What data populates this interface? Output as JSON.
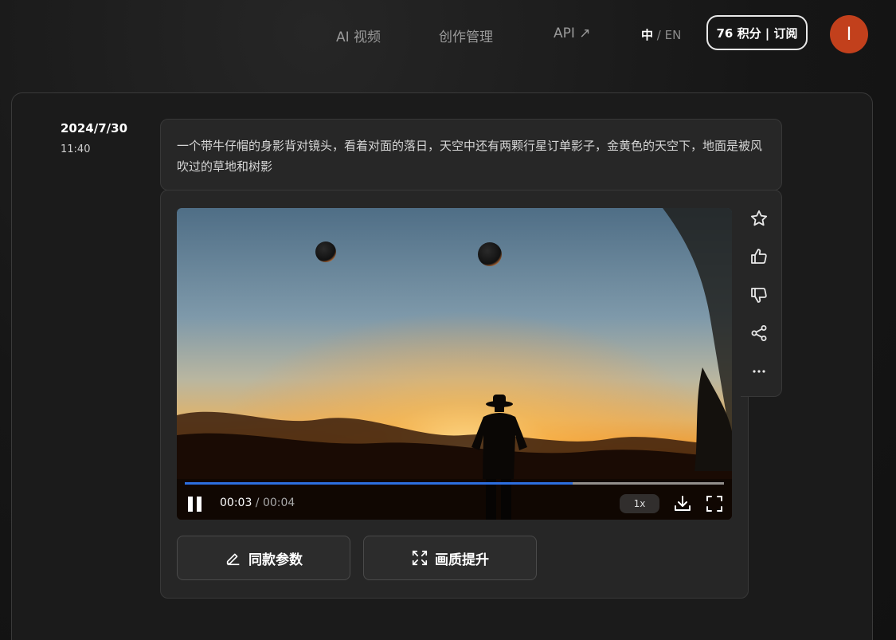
{
  "nav": {
    "items": [
      {
        "label": "AI 视频"
      },
      {
        "label": "创作管理"
      },
      {
        "label": "API ↗"
      }
    ],
    "lang_active": "中",
    "lang_sep": " / ",
    "lang_other": "EN",
    "credits_label": "76 积分 | 订阅",
    "avatar_initial": "I"
  },
  "entry": {
    "date": "2024/7/30",
    "time": "11:40",
    "prompt": "一个带牛仔帽的身影背对镜头，看着对面的落日，天空中还有两颗行星订单影子，金黄色的天空下，地面是被风吹过的草地和树影"
  },
  "video": {
    "current_time": "00:03",
    "separator": " / ",
    "total_time": "00:04",
    "progress": 0.72,
    "speed": "1x"
  },
  "actions": {
    "rail_icons": [
      "star-icon",
      "thumbs-up-icon",
      "thumbs-down-icon",
      "share-icon",
      "more-icon"
    ],
    "same_params_label": "同款参数",
    "upscale_label": "画质提升"
  },
  "colors": {
    "accent": "#2d6fe0",
    "avatar": "#c2401c"
  }
}
